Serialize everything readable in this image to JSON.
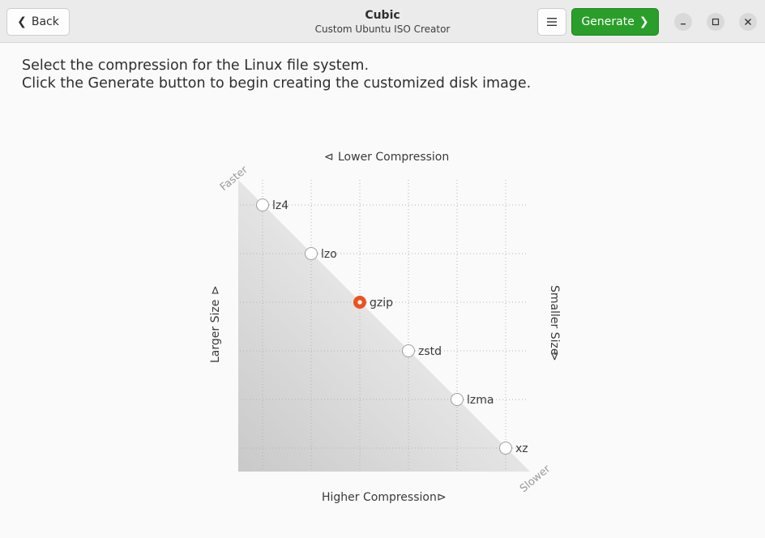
{
  "app": {
    "title": "Cubic",
    "subtitle": "Custom Ubuntu ISO Creator"
  },
  "header": {
    "back_label": "Back",
    "generate_label": "Generate",
    "menu_icon": "hamburger-icon",
    "window_controls": [
      "minimize-icon",
      "maximize-icon",
      "close-icon"
    ]
  },
  "instructions": {
    "line1": "Select the compression for the Linux file system.",
    "line2": "Click the Generate button to begin creating the customized disk image."
  },
  "chart": {
    "top_label": "Lower Compression",
    "bottom_label": "Higher Compression",
    "left_label": "Larger Size",
    "right_label": "Smaller Size",
    "corner_top": "Faster",
    "corner_bottom": "Slower",
    "selected_color": "#e95420"
  },
  "options": [
    {
      "label": "lz4",
      "selected": false
    },
    {
      "label": "lzo",
      "selected": false
    },
    {
      "label": "gzip",
      "selected": true
    },
    {
      "label": "zstd",
      "selected": false
    },
    {
      "label": "lzma",
      "selected": false
    },
    {
      "label": "xz",
      "selected": false
    }
  ]
}
